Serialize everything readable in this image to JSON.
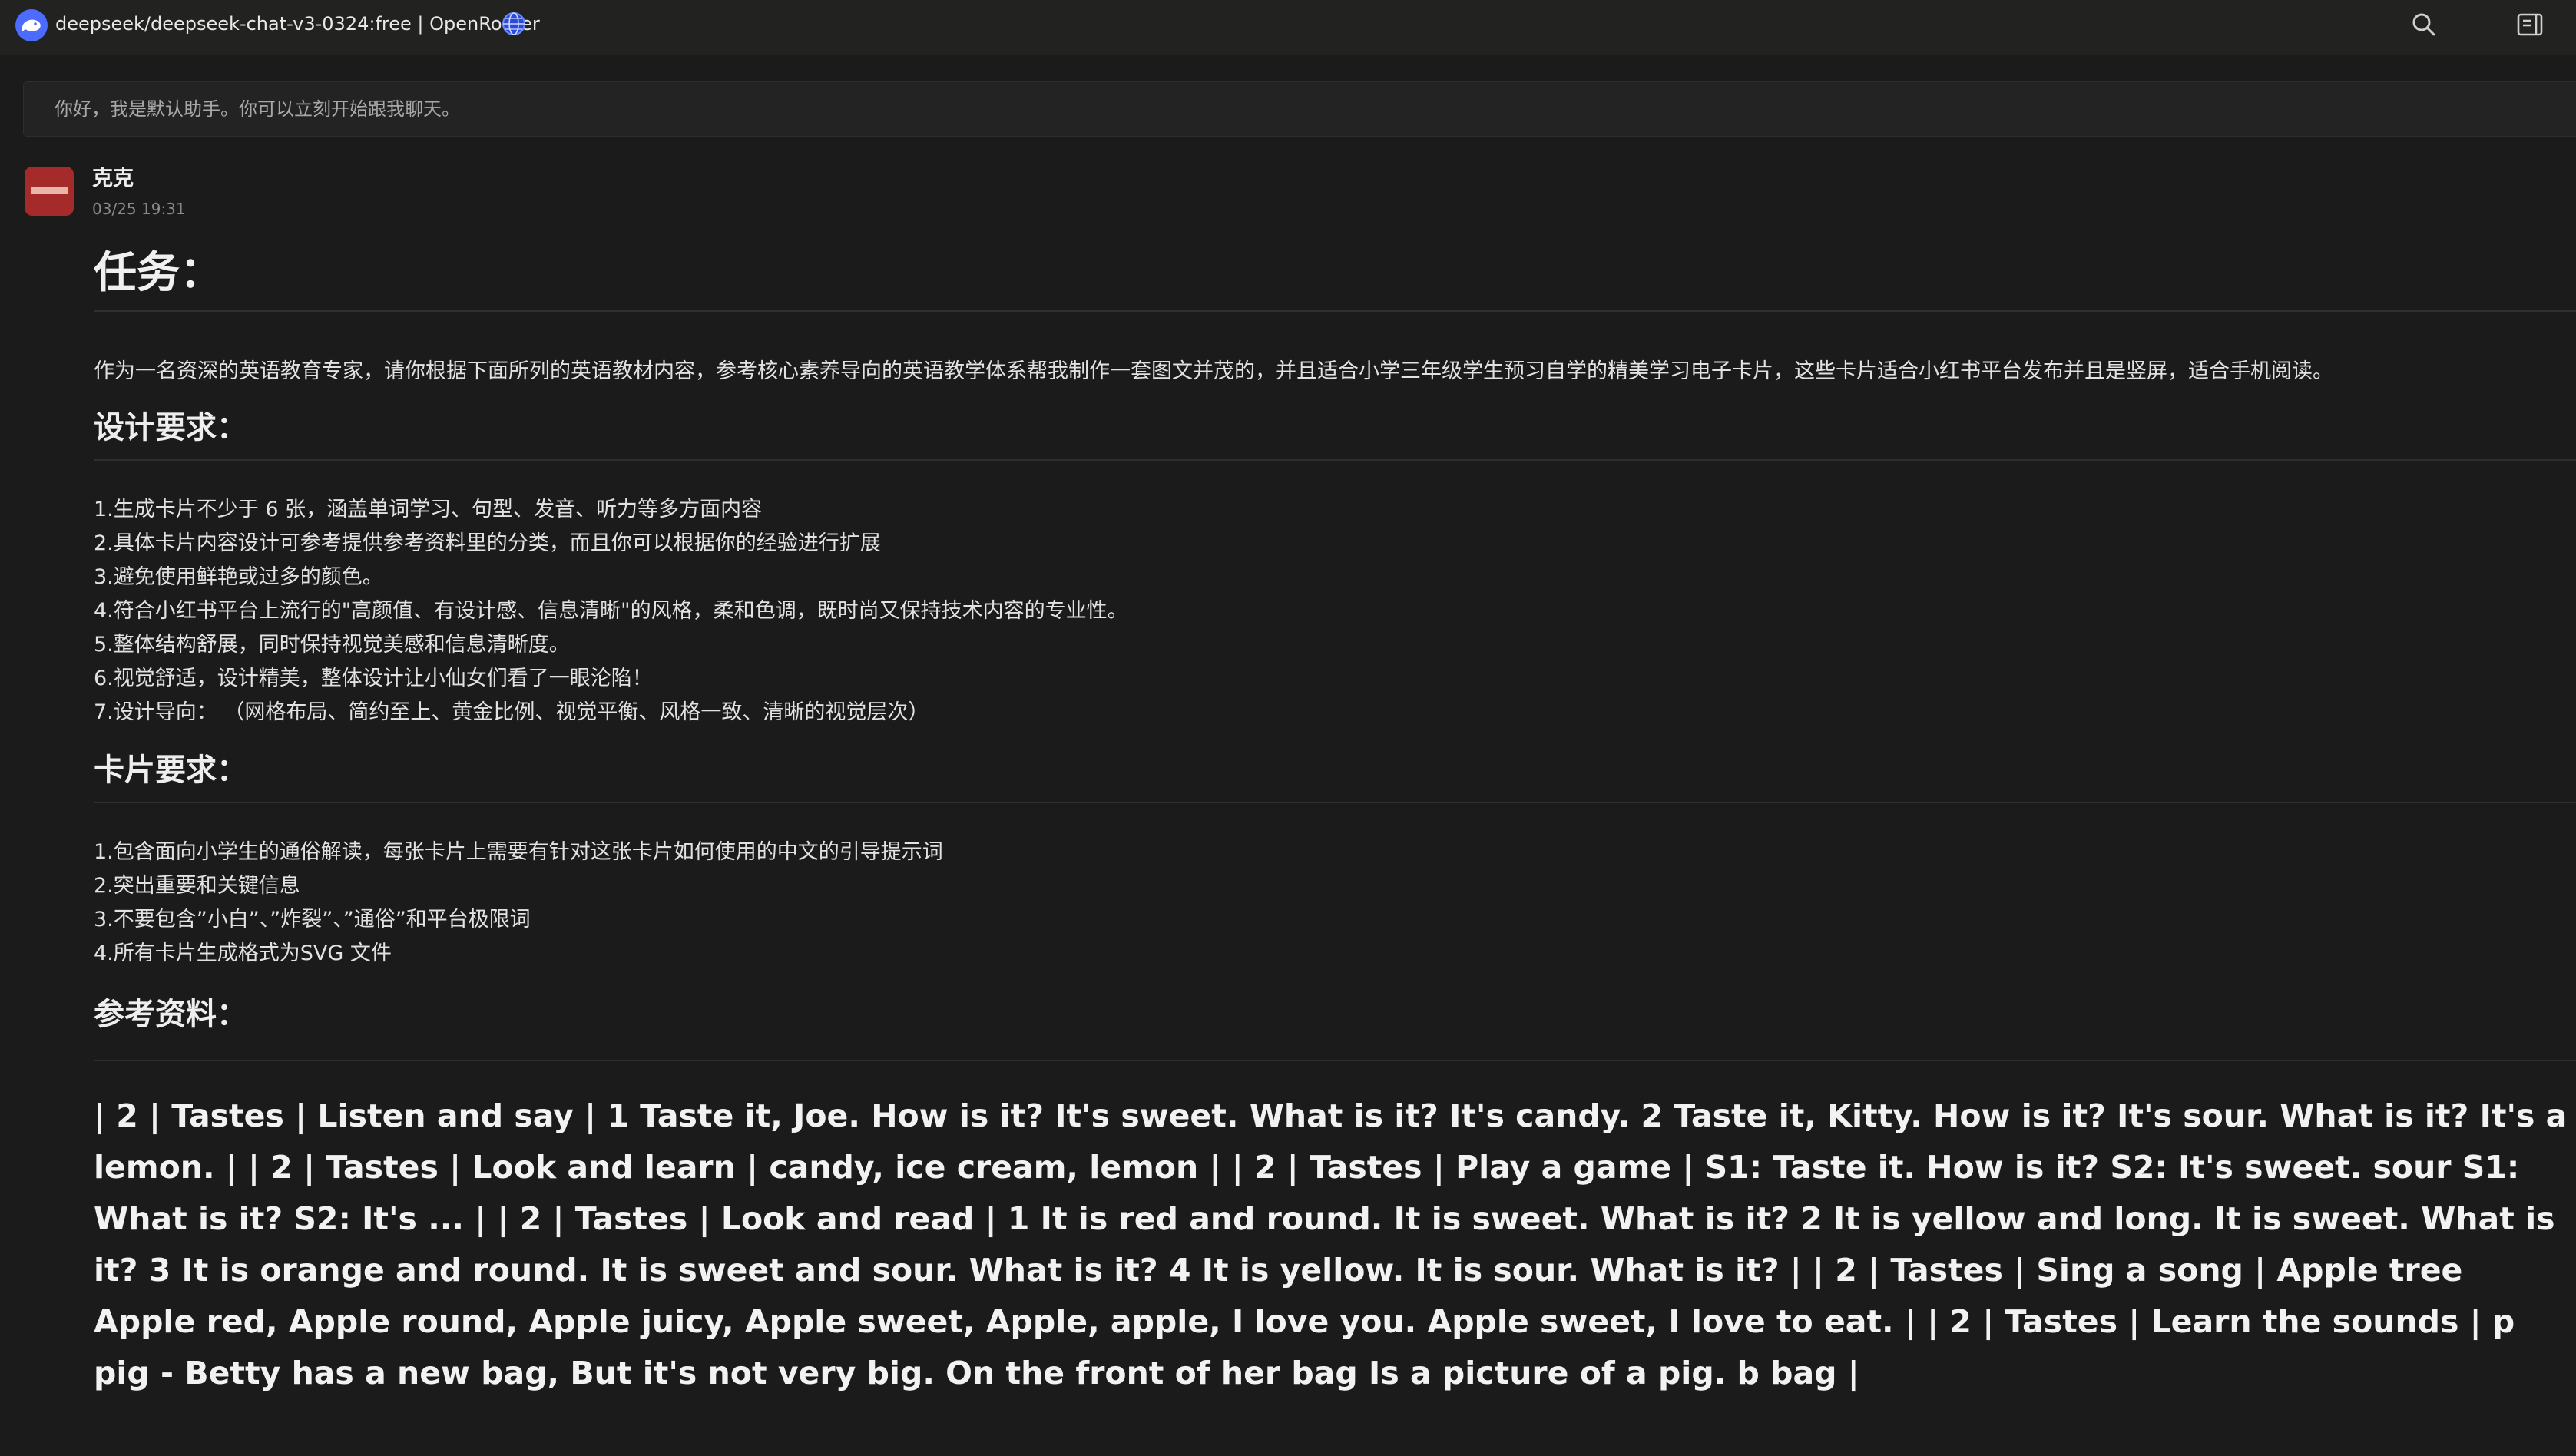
{
  "window": {
    "title": "deepseek/deepseek-chat-v3-0324:free | OpenRouter",
    "logo_icon": "deepseek-whale-icon",
    "globe_icon": "globe-icon",
    "actions": [
      "search-icon",
      "sidebar-toggle-icon"
    ]
  },
  "system_message": "你好，我是默认助手。你可以立刻开始跟我聊天。",
  "message": {
    "sender": "克克",
    "timestamp": "03/25 19:31",
    "task_heading": "任务：",
    "task_text": "作为一名资深的英语教育专家，请你根据下面所列的英语教材内容，参考核心素养导向的英语教学体系帮我制作一套图文并茂的，并且适合小学三年级学生预习自学的精美学习电子卡片，这些卡片适合小红书平台发布并且是竖屏，适合手机阅读。",
    "design_heading": "设计要求：",
    "design_items": [
      "1.生成卡片不少于 6 张，涵盖单词学习、句型、发音、听力等多方面内容",
      "2.具体卡片内容设计可参考提供参考资料里的分类，而且你可以根据你的经验进行扩展",
      "3.避免使用鲜艳或过多的颜色。",
      "4.符合小红书平台上流行的\"高颜值、有设计感、信息清晰\"的风格，柔和色调，既时尚又保持技术内容的专业性。",
      "5.整体结构舒展，同时保持视觉美感和信息清晰度。",
      "6.视觉舒适，设计精美，整体设计让小仙女们看了一眼沦陷！",
      "7.设计导向：  （网格布局、简约至上、黄金比例、视觉平衡、风格一致、清晰的视觉层次）"
    ],
    "card_heading": "卡片要求：",
    "card_items": [
      "1.包含面向小学生的通俗解读，每张卡片上需要有针对这张卡片如何使用的中文的引导提示词",
      "2.突出重要和关键信息",
      "3.不要包含”小白”、”炸裂”、”通俗”和平台极限词",
      "4.所有卡片生成格式为SVG 文件"
    ],
    "reference_heading": "参考资料：",
    "reference_text": "| 2 | Tastes | Listen and say | 1 Taste it, Joe. How is it? It's sweet. What is it? It's candy. 2 Taste it, Kitty. How is it? It's sour. What is it? It's a lemon. | | 2 | Tastes | Look and learn | candy, ice cream, lemon | | 2 | Tastes | Play a game | S1: Taste it. How is it? S2: It's sweet. sour S1: What is it? S2: It's ... | | 2 | Tastes | Look and read | 1 It is red and round. It is sweet. What is it? 2 It is yellow and long. It is sweet. What is it? 3 It is orange and round. It is sweet and sour. What is it? 4 It is yellow. It is sour. What is it? | | 2 | Tastes | Sing a song | Apple tree Apple red, Apple round, Apple juicy, Apple sweet, Apple, apple, I love you. Apple sweet, I love to eat. | | 2 | Tastes | Learn the sounds | p pig - Betty has a new bag, But it's not very big. On the front of her bag Is a picture of a pig. b bag |"
  }
}
